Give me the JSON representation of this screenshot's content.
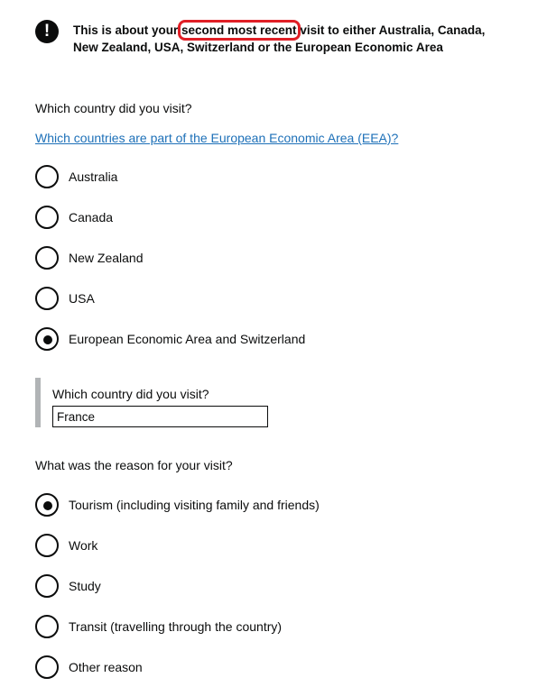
{
  "warning": {
    "icon": "!",
    "text_before": "This is about your ",
    "text_highlight": "second most recent",
    "text_after": " visit to either Australia, Canada, New Zealand, USA, Switzerland or the European Economic Area"
  },
  "country_question": {
    "label": "Which country did you visit?",
    "help_link": "Which countries are part of the European Economic Area (EEA)?",
    "options": [
      {
        "label": "Australia",
        "checked": false
      },
      {
        "label": "Canada",
        "checked": false
      },
      {
        "label": "New Zealand",
        "checked": false
      },
      {
        "label": "USA",
        "checked": false
      },
      {
        "label": "European Economic Area and Switzerland",
        "checked": true
      }
    ],
    "conditional": {
      "label": "Which country did you visit?",
      "value": "France"
    }
  },
  "reason_question": {
    "label": "What was the reason for your visit?",
    "options": [
      {
        "label": "Tourism (including visiting family and friends)",
        "checked": true
      },
      {
        "label": "Work",
        "checked": false
      },
      {
        "label": "Study",
        "checked": false
      },
      {
        "label": "Transit (travelling through the country)",
        "checked": false
      },
      {
        "label": "Other reason",
        "checked": false
      }
    ]
  }
}
